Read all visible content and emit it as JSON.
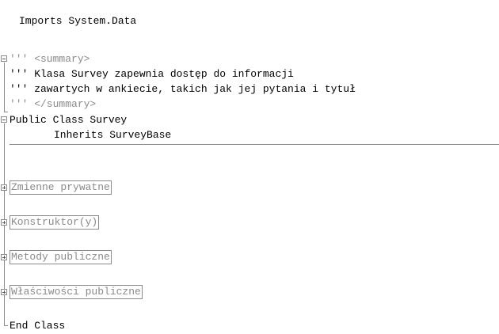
{
  "code": {
    "imports": "Imports System.Data",
    "summary_open": "''' <summary>",
    "summary_line1": "''' Klasa Survey zapewnia dostęp do informacji",
    "summary_line2": "''' zawartych w ankiecie, takich jak jej pytania i tytuł",
    "summary_close": "''' </summary>",
    "class_decl": "Public Class Survey",
    "inherits": "Inherits SurveyBase",
    "regions": [
      "Zmienne prywatne",
      "Konstruktor(y)",
      "Metody publiczne",
      "Właściwości publiczne"
    ],
    "end_class": "End Class"
  },
  "colors": {
    "comment_delimiter": "#8a8a8a",
    "outline": "#8a8a8a",
    "text": "#000000"
  },
  "icons": {
    "collapse": "minus-box-icon",
    "expand": "plus-box-icon"
  }
}
